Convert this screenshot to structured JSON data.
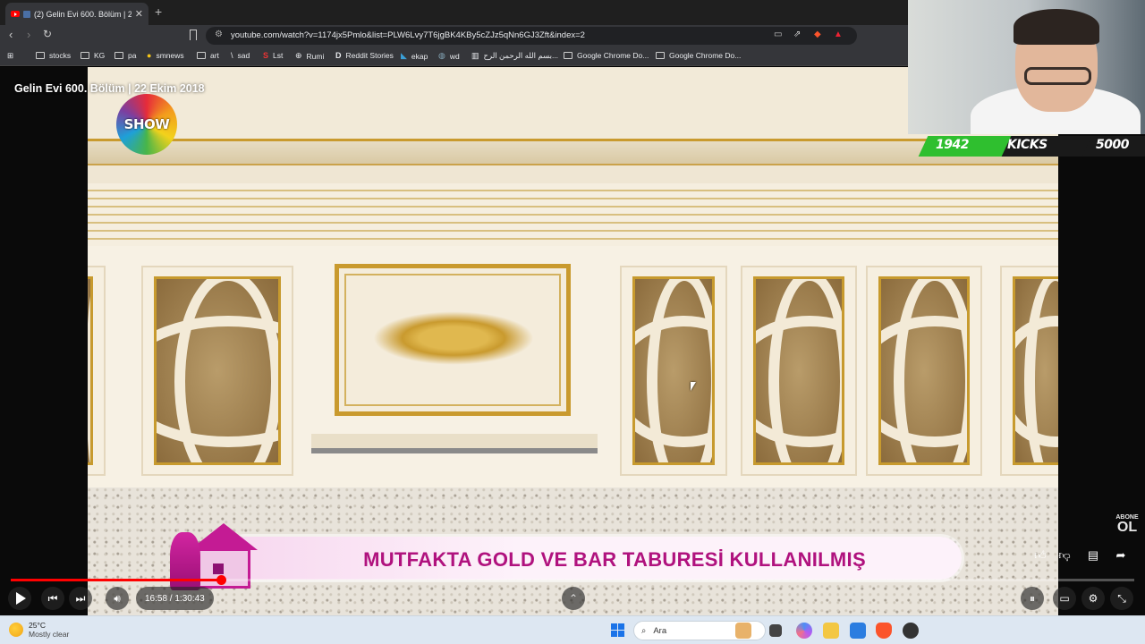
{
  "browser": {
    "tab": {
      "title": "(2) Gelin Evi 600. Bölüm | 22 E",
      "close": "✕"
    },
    "new_tab": "+",
    "url": "youtube.com/watch?v=1174jx5Pmlo&list=PLW6Lvy7T6jgBK4KBy5cZJz5qNn6GJ3Zft&index=2",
    "bookmarks": [
      {
        "label": "stocks",
        "icon": "folder-icon"
      },
      {
        "label": "KG",
        "icon": "folder-icon"
      },
      {
        "label": "pa",
        "icon": "folder-icon"
      },
      {
        "label": "smnews",
        "icon": "dot-icon"
      },
      {
        "label": "art",
        "icon": "folder-icon"
      },
      {
        "label": "sad",
        "icon": "v-icon"
      },
      {
        "label": "Lst",
        "icon": "s-icon"
      },
      {
        "label": "Rumi",
        "icon": "globe-icon"
      },
      {
        "label": "Reddit Stories",
        "icon": "d-icon"
      },
      {
        "label": "ekap",
        "icon": "bird-icon"
      },
      {
        "label": "wd",
        "icon": "wd-icon"
      },
      {
        "label": "بسم الله الرحمن الرح...",
        "icon": "building-icon"
      },
      {
        "label": "Google Chrome Do...",
        "icon": "folder-icon"
      },
      {
        "label": "Google Chrome Do...",
        "icon": "folder-icon"
      }
    ]
  },
  "video": {
    "title": "Gelin Evi 600. Bölüm | 22 Ekim 2018",
    "channel_logo": "SHOW",
    "lower_third": "MUTFAKTA GOLD VE BAR TABURESİ KULLANILMIŞ",
    "abone": {
      "line1": "ABONE",
      "line2": "OL"
    }
  },
  "stream_overlay": {
    "values": [
      "1942",
      "KICKS",
      "5000"
    ],
    "colors": {
      "green": "#2fbf2f",
      "dark": "#1a1a1a"
    }
  },
  "player": {
    "time": "16:58 / 1:30:43",
    "progress": 0.187,
    "side_actions": [
      "thumbs-up-icon",
      "thumbs-down-icon",
      "comment-icon",
      "share-icon"
    ]
  },
  "taskbar": {
    "temperature": "25°C",
    "weather": "Mostly clear",
    "search_placeholder": "Ara"
  }
}
